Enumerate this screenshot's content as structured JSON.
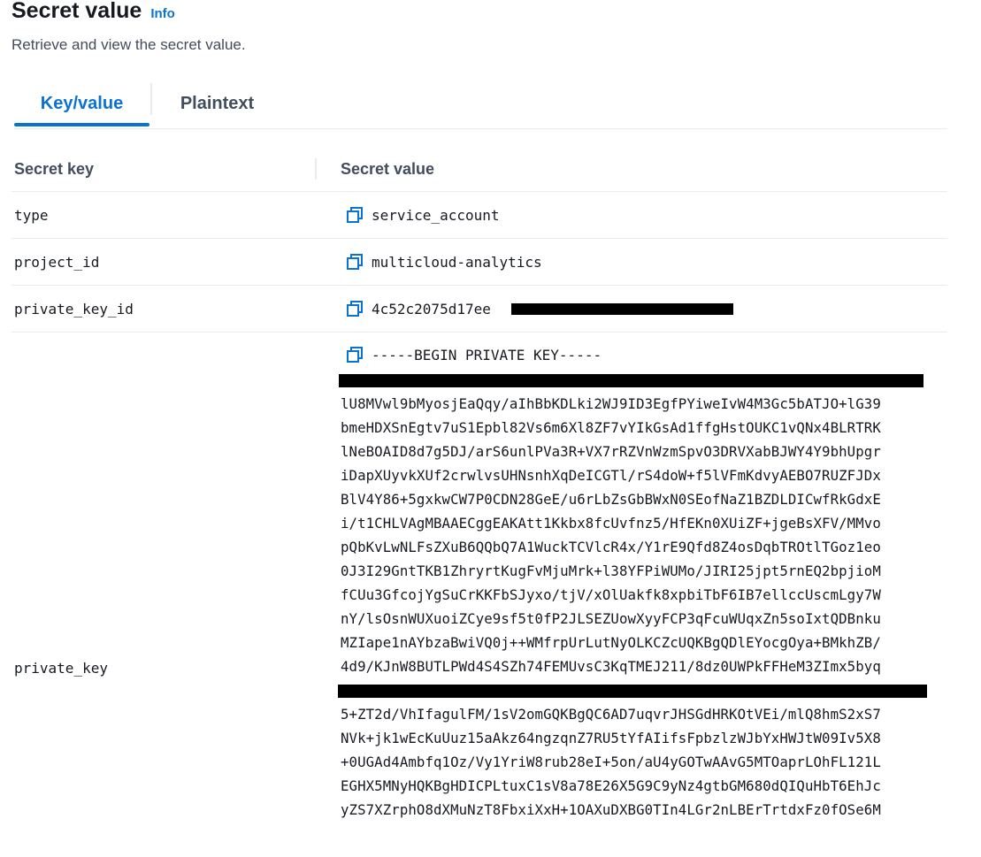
{
  "header": {
    "title": "Secret value",
    "info_label": "Info",
    "description": "Retrieve and view the secret value."
  },
  "tabs": [
    {
      "label": "Key/value",
      "active": true
    },
    {
      "label": "Plaintext",
      "active": false
    }
  ],
  "table": {
    "columns": [
      "Secret key",
      "Secret value"
    ],
    "rows": [
      {
        "key": "type",
        "value": "service_account"
      },
      {
        "key": "project_id",
        "value": "multicloud-analytics"
      },
      {
        "key": "private_key_id",
        "value": "4c52c2075d17ee"
      },
      {
        "key": "private_key",
        "header": "-----BEGIN PRIVATE KEY-----",
        "lines_a": [
          "lU8MVwl9bMyosjEaQqy/aIhBbKDLki2WJ9ID3EgfPYiweIvW4M3Gc5bATJO+lG39",
          "bmeHDXSnEgtv7uS1Epbl82Vs6m6Xl8ZF7vYIkGsAd1ffgHstOUKC1vQNx4BLRTRK",
          "lNeBOAID8d7g5DJ/arS6unlPVa3R+VX7rRZVnWzmSpvO3DRVXabBJWY4Y9bhUpgr",
          "iDapXUyvkXUf2crwlvsUHNsnhXqDeICGTl/rS4doW+f5lVFmKdvyAEBO7RUZFJDx",
          "BlV4Y86+5gxkwCW7P0CDN28GeE/u6rLbZsGbBWxN0SEofNaZ1BZDLDICwfRkGdxE",
          "i/t1CHLVAgMBAAECggEAKAtt1Kkbx8fcUvfnz5/HfEKn0XUiZF+jgeBsXFV/MMvo",
          "pQbKvLwNLFsZXuB6QQbQ7A1WuckTCVlcR4x/Y1rE9Qfd8Z4osDqbTROtlTGoz1eo",
          "0J3I29GntTKB1ZhryrtKugFvMjuMrk+l38YFPiWUMo/JIRI25jpt5rnEQ2bpjioM",
          "fCUu3GfcojYgSuCrKKFbSJyxo/tjV/xOlUakfk8xpbiTbF6IB7ellccUscmLgy7W",
          "nY/lsOsnWUXuoiZCye9sf5t0fP2JLSEZUowXyyFCP3qFcuWUqxZn5soIxtQDBnku",
          "MZIape1nAYbzaBwiVQ0j++WMfrpUrLutNyOLKCZcUQKBgQDlEYocgOya+BMkhZB/",
          "4d9/KJnW8BUTLPWd4S4SZh74FEMUvsC3KqTMEJ211/8dz0UWPkFFHeM3ZImx5byq"
        ],
        "lines_b": [
          "5+ZT2d/VhIfagulFM/1sV2omGQKBgQC6AD7uqvrJHSGdHRKOtVEi/mlQ8hmS2xS7",
          "NVk+jk1wEcKuUuz15aAkz64ngzqnZ7RU5tYfAIifsFpbzlzWJbYxHWJtW09Iv5X8",
          "+0UGAd4Ambfq1Oz/Vy1YriW8rub28eI+5on/aU4yGOTwAAvG5MTOaprLOhFL121L",
          "EGHX5MNyHQKBgHDICPLtuxC1sV8a78E26X5G9C9yNz4gtbGM680dQIQuHbT6EhJc",
          "yZS7XZrphO8dXMuNzT8FbxiXxH+1OAXuDXBG0TIn4LGr2nLBErTrtdxFz0fOSe6M"
        ]
      }
    ]
  },
  "icons": {
    "copy": "copy-icon"
  },
  "colors": {
    "accent": "#0972d3",
    "text": "#16191f",
    "muted": "#414d5c",
    "border": "#e9ebed"
  }
}
